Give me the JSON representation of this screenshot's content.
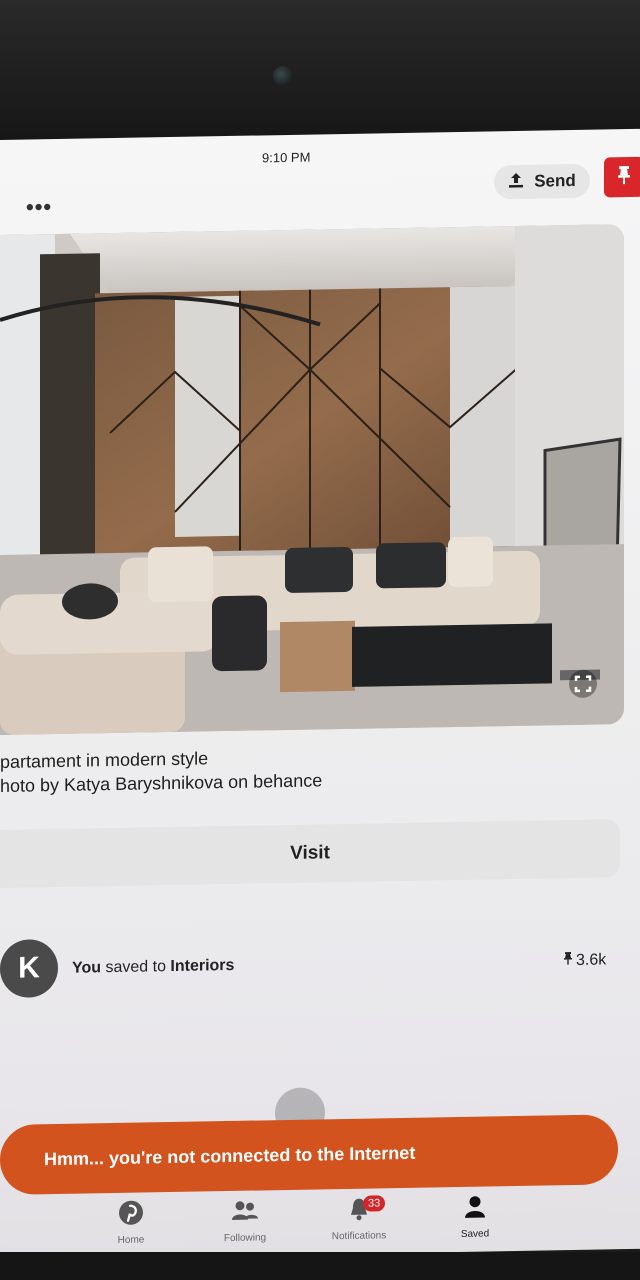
{
  "status_bar": {
    "time": "9:10 PM"
  },
  "header": {
    "more_label": "•••",
    "send_label": "Send"
  },
  "pin": {
    "description_line1": "partament in modern style",
    "description_line2": "hoto by Katya Baryshnikova on behance",
    "visit_label": "Visit"
  },
  "activity": {
    "avatar_letter": "K",
    "actor": "You",
    "action": " saved to ",
    "board": "Interiors",
    "save_count": "3.6k"
  },
  "toast": {
    "message": "Hmm... you're not connected to the Internet"
  },
  "tabbar": {
    "tabs": [
      {
        "label": "Home",
        "icon": "pinterest-icon"
      },
      {
        "label": "Following",
        "icon": "people-icon"
      },
      {
        "label": "Notifications",
        "icon": "bell-icon",
        "badge": "33"
      },
      {
        "label": "Saved",
        "icon": "person-icon",
        "active": true
      }
    ]
  },
  "colors": {
    "brand_red": "#d8262a",
    "toast_orange": "#d2531e"
  }
}
